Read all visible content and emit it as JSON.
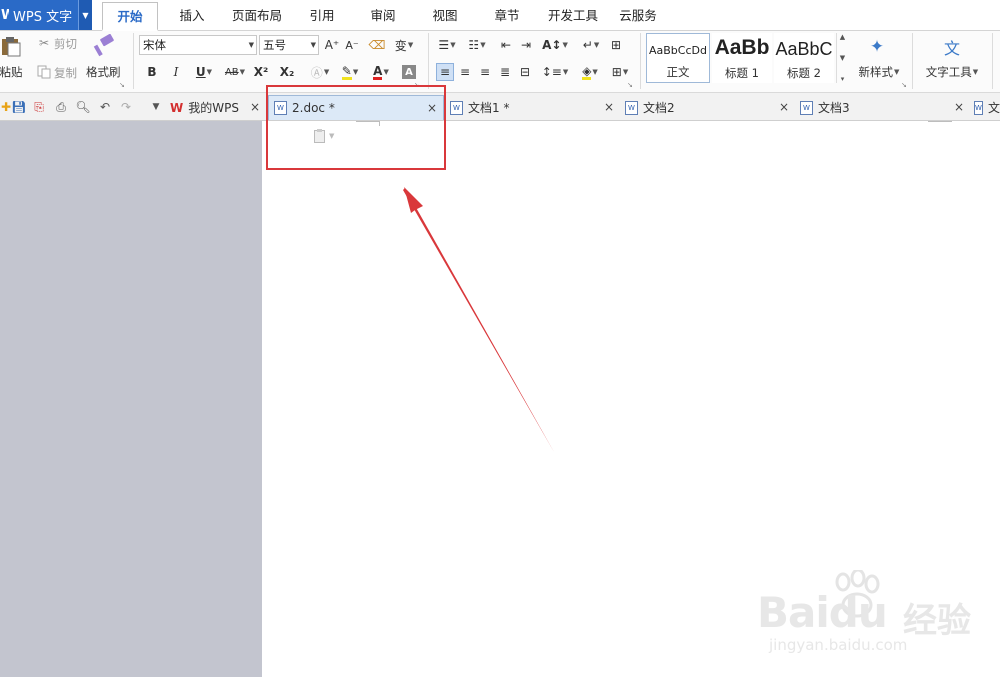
{
  "app": {
    "title": "WPS 文字",
    "letter": "W",
    "accent_color": "#2a6ac7"
  },
  "menu": {
    "tabs": [
      "开始",
      "插入",
      "页面布局",
      "引用",
      "审阅",
      "视图",
      "章节",
      "开发工具",
      "云服务"
    ],
    "active_tab": "开始"
  },
  "ribbon": {
    "clipboard": {
      "paste_label": "粘贴",
      "cut_label": "剪切",
      "copy_label": "复制",
      "format_painter_label": "格式刷"
    },
    "font": {
      "font_name": "宋体",
      "font_size": "五号",
      "bold": "B",
      "italic": "I",
      "underline": "U",
      "strikethrough": "AB",
      "superscript": "X²",
      "subscript": "X₂",
      "font_color_letter": "A",
      "char_shading_letter": "A",
      "grow_font": "A⁺",
      "shrink_font": "A⁻",
      "pinyin": "变"
    },
    "styles": {
      "items": [
        {
          "sample": "AaBbCcDd",
          "name": "正文"
        },
        {
          "sample": "AaBb",
          "name": "标题 1"
        },
        {
          "sample": "AaBbC",
          "name": "标题 2"
        }
      ],
      "new_style_label": "新样式",
      "text_tools_label": "文字工具"
    }
  },
  "tabbar": {
    "tabs": [
      {
        "label": "我的WPS",
        "close": "×"
      },
      {
        "label": "2.doc *",
        "close": "×"
      },
      {
        "label": "文档1 *",
        "close": "×"
      },
      {
        "label": "文档2",
        "close": "×"
      },
      {
        "label": "文档3",
        "close": "×"
      },
      {
        "label": "文",
        "close": "×"
      }
    ],
    "active_tab": "2.doc *"
  },
  "annotation": {
    "highlight_color": "#d9383b"
  },
  "watermark": {
    "brand": "Baidu",
    "cn": "经验",
    "url": "jingyan.baidu.com"
  }
}
